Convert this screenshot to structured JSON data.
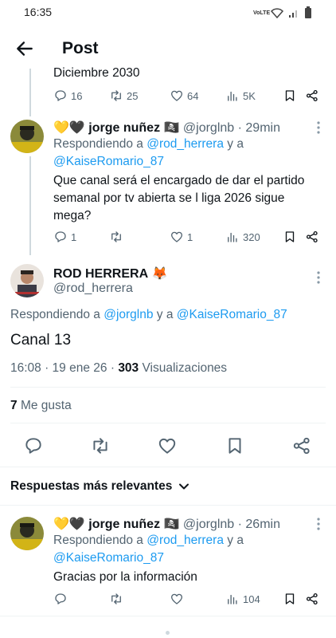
{
  "status_bar": {
    "time": "16:35",
    "network": "VoLTE"
  },
  "header": {
    "title": "Post"
  },
  "previous_post": {
    "text_fragment": "Diciembre 2030",
    "replies": "16",
    "reposts": "25",
    "likes": "64",
    "views": "5K"
  },
  "reply_1": {
    "display_name": "jorge nuñez",
    "name_emojis_prefix": "💛🖤",
    "name_emoji_suffix": "🏴‍☠️",
    "handle": "@jorglnb",
    "time": "29min",
    "replying_label": "Respondiendo a",
    "mention_1": "@rod_herrera",
    "connector": "y a",
    "mention_2": "@KaiseRomario_87",
    "text_line_1": "Que canal será el encargado de dar el partido",
    "text_line_2": "semanal por tv abierta se l liga 2026 sigue",
    "text_line_3": "mega?",
    "replies": "1",
    "reposts": "",
    "likes": "1",
    "views": "320"
  },
  "main_post": {
    "display_name": "ROD HERRERA",
    "name_emoji": "🦊",
    "handle": "@rod_herrera",
    "replying_label": "Respondiendo a",
    "mention_1": "@jorglnb",
    "connector": "y a",
    "mention_2": "@KaiseRomario_87",
    "text": "Canal 13",
    "timestamp": "16:08 · 19 ene 26 ·",
    "views_count": "303",
    "views_label": "Visualizaciones",
    "likes_count": "7",
    "likes_label": "Me gusta"
  },
  "sort": {
    "label": "Respuestas más relevantes"
  },
  "reply_2": {
    "display_name": "jorge nuñez",
    "name_emojis_prefix": "💛🖤",
    "name_emoji_suffix": "🏴‍☠️",
    "handle": "@jorglnb",
    "time": "26min",
    "replying_label": "Respondiendo a",
    "mention_1": "@rod_herrera",
    "connector": "y a",
    "mention_2": "@KaiseRomario_87",
    "text": "Gracias por la información",
    "replies": "",
    "reposts": "",
    "likes": "",
    "views": "104"
  },
  "colors": {
    "accent": "#1d9bf0",
    "secondary_text": "#536471",
    "divider": "#eff3f4"
  },
  "icons": [
    "back-arrow-icon",
    "reply-icon",
    "repost-icon",
    "like-icon",
    "views-icon",
    "bookmark-icon",
    "share-icon",
    "more-icon",
    "chevron-down-icon"
  ]
}
